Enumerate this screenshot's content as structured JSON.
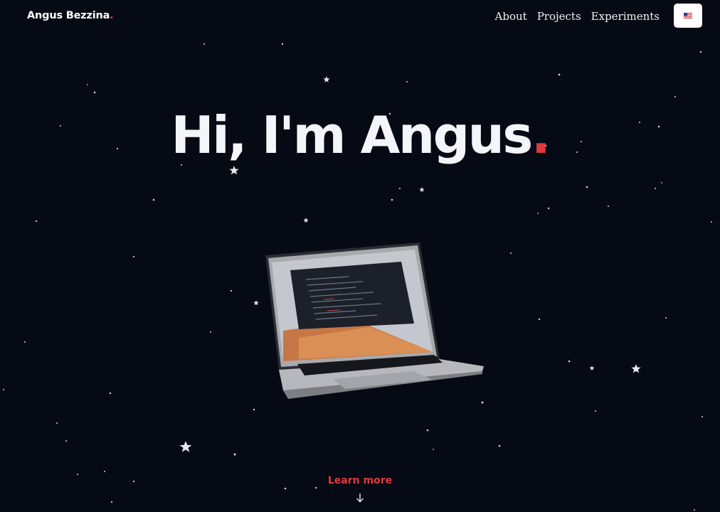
{
  "header": {
    "brand": "Angus Bezzina",
    "brand_dot": ".",
    "nav": [
      {
        "label": "About"
      },
      {
        "label": "Projects"
      },
      {
        "label": "Experiments"
      }
    ],
    "language_icon": "us-flag-icon"
  },
  "hero": {
    "title": "Hi, I'm Angus",
    "title_dot": ".",
    "illustration_icon": "laptop-icon"
  },
  "cta": {
    "label": "Learn more",
    "icon": "arrow-down-icon"
  },
  "colors": {
    "background": "#060a14",
    "accent": "#e0393c",
    "text": "#f3f5f9"
  }
}
